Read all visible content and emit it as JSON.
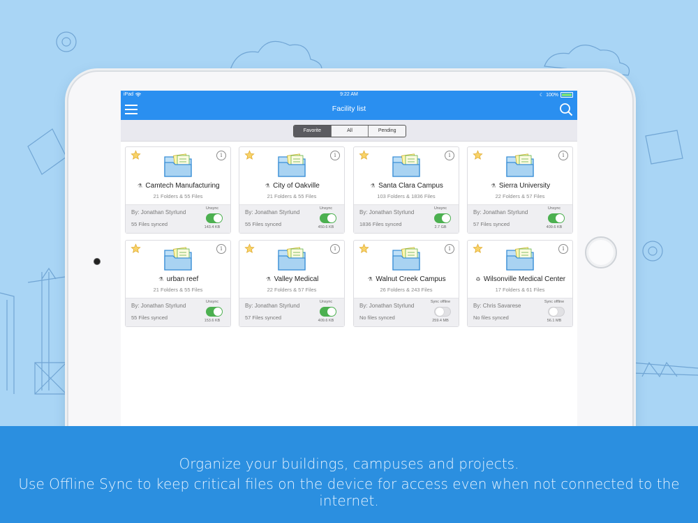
{
  "status_bar": {
    "device": "iPad",
    "time": "9:22 AM",
    "battery": "100%"
  },
  "nav": {
    "title": "Facility list",
    "menu_icon": "hamburger-icon",
    "search_icon": "search-icon"
  },
  "segments": [
    {
      "label": "Favorite",
      "active": true
    },
    {
      "label": "All",
      "active": false
    },
    {
      "label": "Pending",
      "active": false
    }
  ],
  "facilities": [
    {
      "name": "Camtech Manufacturing",
      "counts": "21 Folders & 55 Files",
      "by": "By: Jonathan Styrlund",
      "synced": "55 Files synced",
      "sync_label": "Unsync",
      "sync_on": true,
      "size": "143.4 KB",
      "type_icon": "building-icon"
    },
    {
      "name": "City of Oakville",
      "counts": "21 Folders & 55 Files",
      "by": "By: Jonathan Styrlund",
      "synced": "55 Files synced",
      "sync_label": "Unsync",
      "sync_on": true,
      "size": "450.6 KB",
      "type_icon": "building-icon"
    },
    {
      "name": "Santa Clara Campus",
      "counts": "103 Folders & 1836 Files",
      "by": "By: Jonathan Styrlund",
      "synced": "1836 Files synced",
      "sync_label": "Unsync",
      "sync_on": true,
      "size": "2.7 GB",
      "type_icon": "building-icon"
    },
    {
      "name": "Sierra University",
      "counts": "22 Folders & 57 Files",
      "by": "By: Jonathan Styrlund",
      "synced": "57 Files synced",
      "sync_label": "Unsync",
      "sync_on": true,
      "size": "409.6 KB",
      "type_icon": "building-icon"
    },
    {
      "name": "urban reef",
      "counts": "21 Folders & 55 Files",
      "by": "By: Jonathan Styrlund",
      "synced": "55 Files synced",
      "sync_label": "Unsync",
      "sync_on": true,
      "size": "153.6 KB",
      "type_icon": "building-icon"
    },
    {
      "name": "Valley Medical",
      "counts": "22 Folders & 57 Files",
      "by": "By: Jonathan Styrlund",
      "synced": "57 Files synced",
      "sync_label": "Unsync",
      "sync_on": true,
      "size": "409.6 KB",
      "type_icon": "building-icon"
    },
    {
      "name": "Walnut Creek Campus",
      "counts": "26 Folders & 243 Files",
      "by": "By: Jonathan Styrlund",
      "synced": "No files synced",
      "sync_label": "Sync offline",
      "sync_on": false,
      "size": "259.4 MB",
      "type_icon": "building-icon"
    },
    {
      "name": "Wilsonville Medical Center",
      "counts": "17 Folders & 61 Files",
      "by": "By: Chris Savarese",
      "synced": "No files synced",
      "sync_label": "Sync offline",
      "sync_on": false,
      "size": "56.1 MB",
      "type_icon": "recycle-icon"
    }
  ],
  "banner": {
    "line1": "Organize your buildings, campuses and projects.",
    "line2": "Use Offline Sync to keep critical files on the device for access even when not connected to the internet."
  }
}
